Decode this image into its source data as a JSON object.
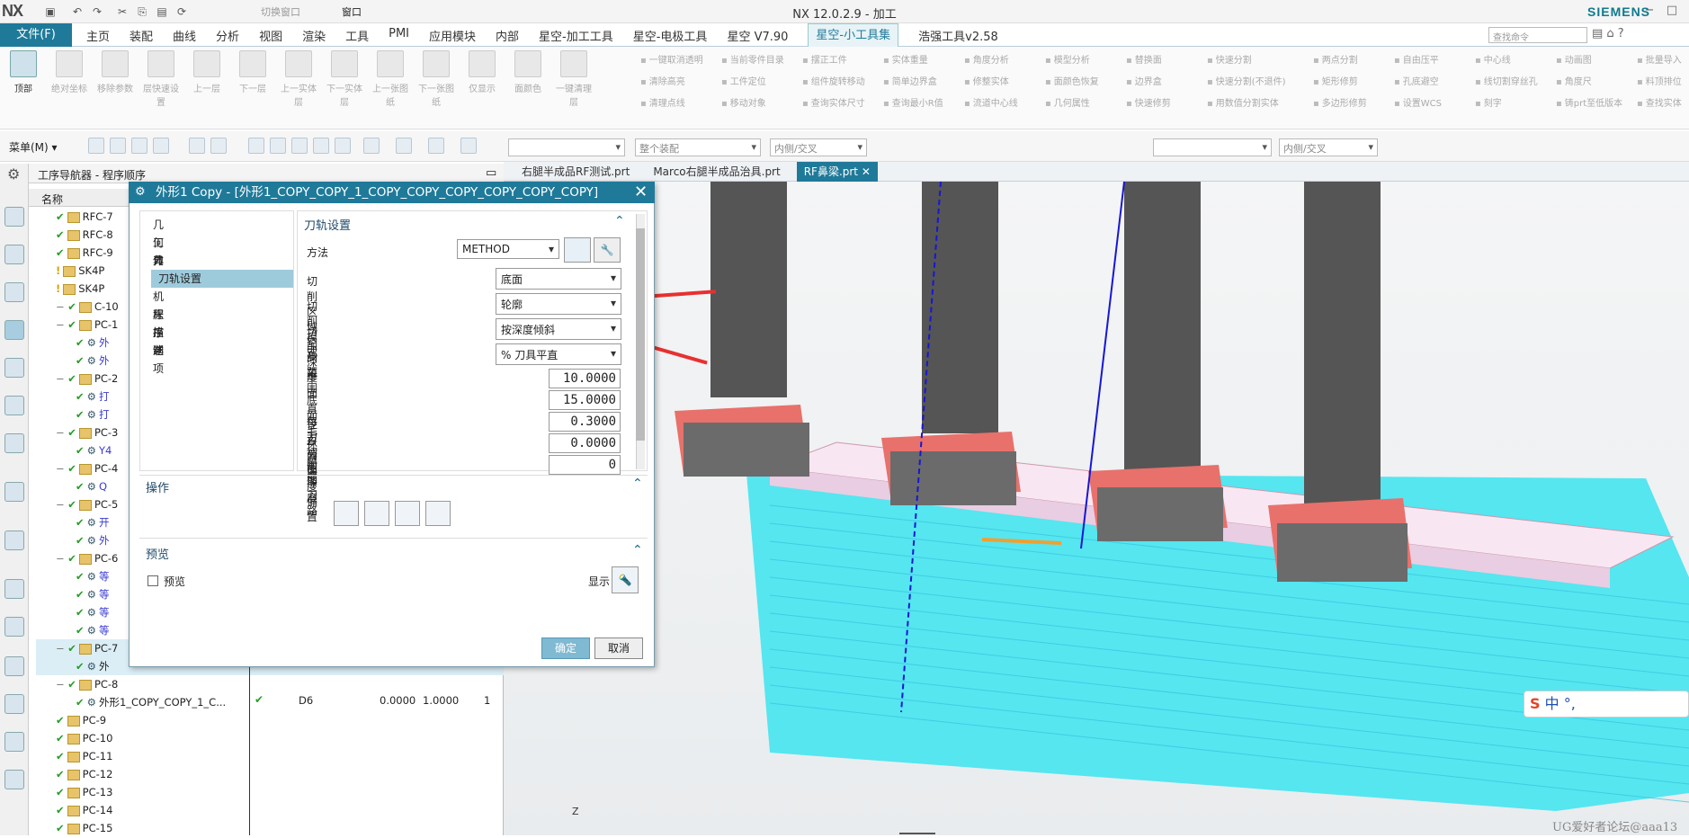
{
  "app": {
    "logo": "NX",
    "title": "NX 12.0.2.9 - 加工",
    "brand": "SIEMENS",
    "switch_window": "切换窗口",
    "window_menu": "窗口",
    "search_placeholder": "查找命令"
  },
  "menu": {
    "file": "文件(F)",
    "items": [
      "主页",
      "装配",
      "曲线",
      "分析",
      "视图",
      "渲染",
      "工具",
      "PMI",
      "应用模块",
      "内部",
      "星空-加工工具",
      "星空-电极工具",
      "星空 V7.90",
      "星空-小工具集",
      "浩强工具v2.58"
    ],
    "active": "星空-小工具集"
  },
  "ribbon": {
    "big": [
      "顶部",
      "绝对坐标",
      "移除参数",
      "层快速设置",
      "上一层",
      "下一层",
      "上一实体层",
      "下一实体层",
      "上一张图纸",
      "下一张图纸",
      "仅显示",
      "面颜色",
      "一键清理层"
    ],
    "cols": [
      [
        "一键取消透明",
        "清除高亮",
        "清理点线"
      ],
      [
        "当前零件目录",
        "工件定位",
        "移动对象"
      ],
      [
        "摆正工件",
        "组件旋转移动",
        "查询实体尺寸"
      ],
      [
        "实体重量",
        "简单边界盒",
        "查询最小R值"
      ],
      [
        "角度分析",
        "修整实体",
        "流道中心线"
      ],
      [
        "模型分析",
        "面颜色恢复",
        "几何属性"
      ],
      [
        "替换面",
        "边界盒",
        "快速修剪"
      ],
      [
        "快速分割",
        "快速分割(不退件)",
        "用数值分割实体"
      ],
      [
        "两点分割",
        "矩形修剪",
        "多边形修剪"
      ],
      [
        "自由压平",
        "孔底避空",
        "设置WCS"
      ],
      [
        "中心线",
        "线切割穿丝孔",
        "刻字"
      ],
      [
        "动画图",
        "角度尺",
        "铸prt至低版本"
      ],
      [
        "批量导入",
        "料顶排位",
        "查找实体"
      ]
    ]
  },
  "toolbar2": {
    "menu": "菜单(M)",
    "filter1": "",
    "filter2": "整个装配",
    "filter3": "内侧/交叉",
    "filter4": "",
    "filter5": "内侧/交叉"
  },
  "nav": {
    "title": "工序导航器 - 程序顺序",
    "col_name": "名称",
    "rows": [
      "RFC-7",
      "RFC-8",
      "RFC-9",
      "SK4P",
      "SK4P",
      "C-10",
      "PC-1",
      "外",
      "外",
      "PC-2",
      "打",
      "打",
      "PC-3",
      "Y4",
      "PC-4",
      "Q",
      "PC-5",
      "开",
      "外",
      "PC-6",
      "等",
      "等",
      "等",
      "等",
      "PC-7",
      "外",
      "PC-8",
      "外形1_COPY_COPY_1_C...",
      "PC-9",
      "PC-10",
      "PC-11",
      "PC-12",
      "PC-13",
      "PC-14",
      "PC-15"
    ],
    "pc8_tool": "D6",
    "pc8_v1": "0.0000",
    "pc8_v2": "1.0000",
    "pc8_v3": "1"
  },
  "tabs": [
    "右腿半成品RF测试.prt",
    "Marco右腿半成品治具.prt",
    "RF鼻梁.prt"
  ],
  "dialog": {
    "title": "外形1 Copy - [外形1_COPY_COPY_1_COPY_COPY_COPY_COPY_COPY_COPY]",
    "left": [
      "几何体",
      "工具",
      "刀轴",
      "刀轨设置",
      "机床控制",
      "程序",
      "描述",
      "选项"
    ],
    "section": "刀轨设置",
    "method_label": "方法",
    "method_value": "METHOD",
    "rows": [
      {
        "label": "切削区域空间范围",
        "value": "底面"
      },
      {
        "label": "切削模式",
        "value": "轮廓"
      },
      {
        "label": "切削深度",
        "value": "按深度倾斜"
      },
      {
        "label": "步距",
        "value": "% 刀具平直"
      },
      {
        "label": "平面直径百分比",
        "value": "10.0000"
      },
      {
        "label": "底面毛坯厚度",
        "value": "15.0000"
      },
      {
        "label": "每刀切削深度",
        "value": "0.3000"
      },
      {
        "label": "Z 向深度偏置",
        "value": "0.0000"
      },
      {
        "label": "附加刀路",
        "value": "0"
      }
    ],
    "ops": "操作",
    "preview": "预览",
    "preview_chk": "预览",
    "show": "显示",
    "ok": "确定",
    "cancel": "取消"
  },
  "ime": "中 °,",
  "watermark": "UG爱好者论坛@aaa13",
  "axis": "Z"
}
